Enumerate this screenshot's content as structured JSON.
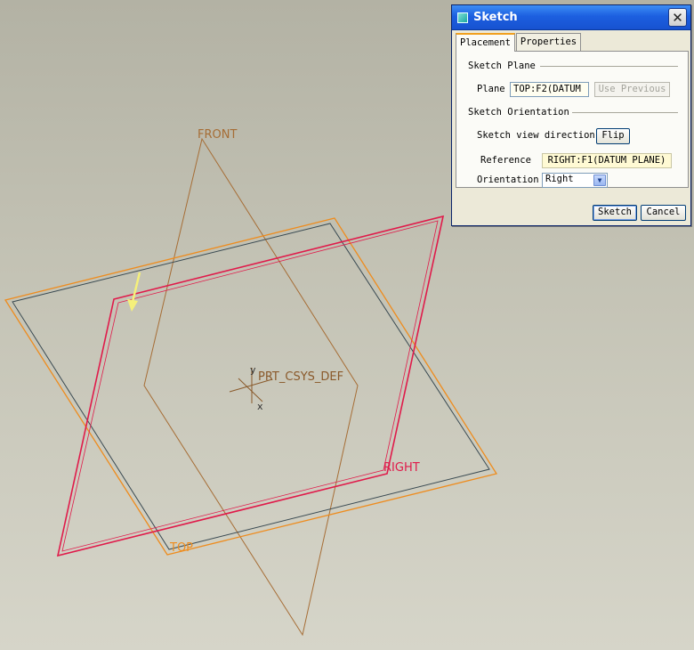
{
  "viewport": {
    "labels": {
      "front": "FRONT",
      "top": "TOP",
      "right": "RIGHT",
      "csys": "PRT_CSYS_DEF",
      "axis_y": "y",
      "axis_x": "x"
    },
    "colors": {
      "front": "#a66d35",
      "top": "#ee8c1e",
      "top_inner": "#3a4a52",
      "right": "#e01a4a",
      "arrow": "#f5f07a",
      "csys": "#8a5a2b"
    }
  },
  "dialog": {
    "title": "Sketch",
    "close_icon": "close-icon",
    "tabs": [
      {
        "label": "Placement",
        "active": true
      },
      {
        "label": "Properties",
        "active": false
      }
    ],
    "sketch_plane": {
      "group_title": "Sketch Plane",
      "plane_label": "Plane",
      "plane_value": "TOP:F2(DATUM",
      "use_previous_label": "Use Previous"
    },
    "sketch_orientation": {
      "group_title": "Sketch Orientation",
      "view_direction_label": "Sketch view direction",
      "flip_label": "Flip",
      "reference_label": "Reference",
      "reference_value": "RIGHT:F1(DATUM PLANE)",
      "orientation_label": "Orientation",
      "orientation_value": "Right"
    },
    "buttons": {
      "sketch": "Sketch",
      "cancel": "Cancel"
    }
  }
}
